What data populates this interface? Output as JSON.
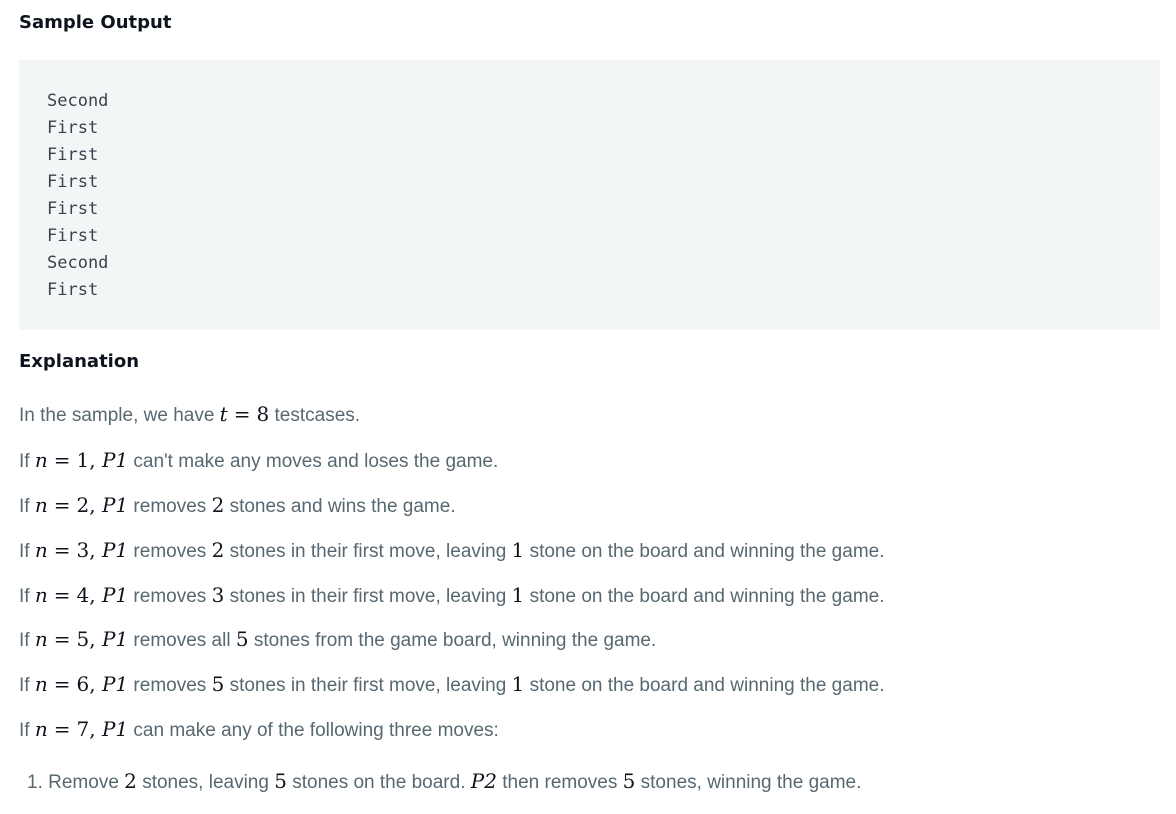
{
  "sample_output": {
    "heading": "Sample Output",
    "lines": [
      "Second",
      "First",
      "First",
      "First",
      "First",
      "First",
      "Second",
      "First"
    ]
  },
  "explanation": {
    "heading": "Explanation",
    "intro": {
      "before": "In the sample, we have",
      "var": "t",
      "eq": "=",
      "num": "8",
      "after": "testcases."
    },
    "cases": [
      {
        "if": "If",
        "n_var": "n",
        "eq": "=",
        "n_val": "1",
        "comma": ",",
        "player": "P1",
        "rest": "can't make any moves and loses the game."
      },
      {
        "if": "If",
        "n_var": "n",
        "eq": "=",
        "n_val": "2",
        "comma": ",",
        "player": "P1",
        "t1": "removes",
        "m1": "2",
        "t2": "stones and wins the game."
      },
      {
        "if": "If",
        "n_var": "n",
        "eq": "=",
        "n_val": "3",
        "comma": ",",
        "player": "P1",
        "t1": "removes",
        "m1": "2",
        "t2": "stones in their first move, leaving",
        "m2": "1",
        "t3": "stone on the board and winning the game."
      },
      {
        "if": "If",
        "n_var": "n",
        "eq": "=",
        "n_val": "4",
        "comma": ",",
        "player": "P1",
        "t1": "removes",
        "m1": "3",
        "t2": "stones in their first move, leaving",
        "m2": "1",
        "t3": "stone on the board and winning the game."
      },
      {
        "if": "If",
        "n_var": "n",
        "eq": "=",
        "n_val": "5",
        "comma": ",",
        "player": "P1",
        "t1": "removes all",
        "m1": "5",
        "t2": "stones from the game board, winning the game."
      },
      {
        "if": "If",
        "n_var": "n",
        "eq": "=",
        "n_val": "6",
        "comma": ",",
        "player": "P1",
        "t1": "removes",
        "m1": "5",
        "t2": "stones in their first move, leaving",
        "m2": "1",
        "t3": "stone on the board and winning the game."
      },
      {
        "if": "If",
        "n_var": "n",
        "eq": "=",
        "n_val": "7",
        "comma": ",",
        "player": "P1",
        "rest": "can make any of the following three moves:"
      }
    ],
    "list": [
      {
        "marker": "1.",
        "t1": "Remove",
        "m1": "2",
        "t2": "stones, leaving",
        "m2": "5",
        "t3": "stones on the board.",
        "player": "P2",
        "t4": "then removes",
        "m3": "5",
        "t5": "stones, winning the game."
      }
    ]
  }
}
